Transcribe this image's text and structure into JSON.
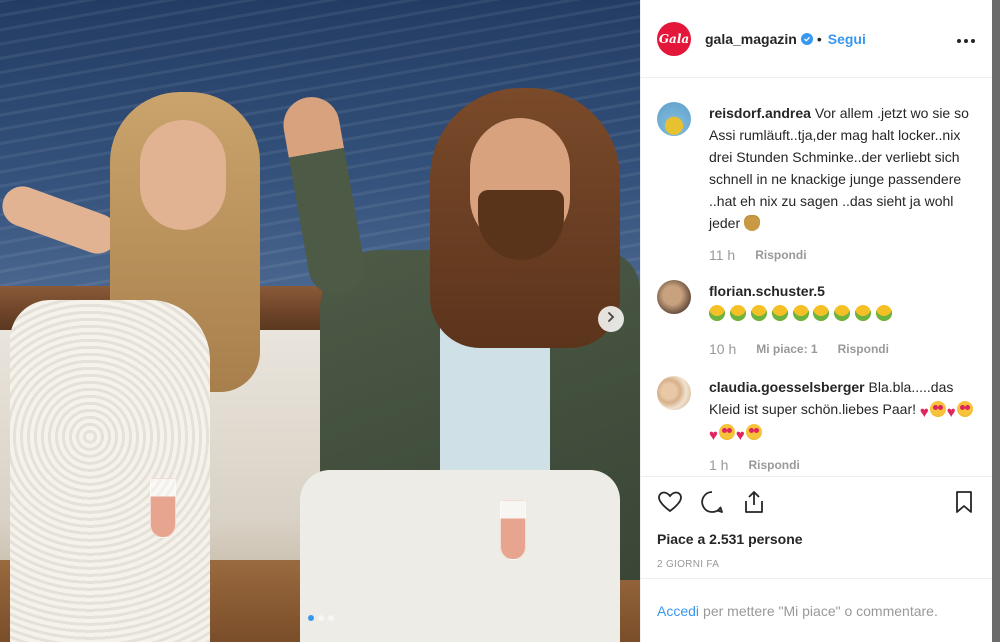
{
  "post": {
    "account": {
      "avatar_text": "Gala",
      "username": "gala_magazin",
      "separator": "•",
      "follow_label": "Segui",
      "more_label": "•••",
      "brand_color": "#e4173a",
      "verified_icon": "verified-badge-icon"
    },
    "carousel": {
      "next_icon": "chevron-right-icon",
      "slide_count": 3,
      "active_slide": 1
    },
    "comments": [
      {
        "username": "reisdorf.andrea",
        "text": "Vor allem .jetzt wo sie so Assi rumläuft..tja,der mag halt locker..nix drei Stunden Schminke..der verliebt sich schnell in ne knackige junge passendere ..hat eh nix zu sagen ..das sieht ja wohl jeder",
        "emoji": "money-bag-emoji",
        "time": "11 h",
        "reply_label": "Rispondi"
      },
      {
        "username": "florian.schuster.5",
        "emoji": "nauseated-face-emoji",
        "emoji_count": 9,
        "time": "10 h",
        "likes_label": "Mi piace: 1",
        "reply_label": "Rispondi"
      },
      {
        "username": "claudia.goesselsberger",
        "text_line1": "Bla.bla.....das Kleid ist super schön.liebes Paar!",
        "emoji_sequence": [
          "heart",
          "heart-eyes",
          "heart",
          "heart-eyes",
          "heart",
          "heart-eyes",
          "heart",
          "heart-eyes"
        ],
        "time": "1 h",
        "reply_label": "Rispondi"
      }
    ],
    "actions": {
      "like_icon": "heart-icon",
      "comment_icon": "comment-bubble-icon",
      "share_icon": "share-upload-icon",
      "save_icon": "bookmark-icon"
    },
    "likes_text": "Piace a 2.531 persone",
    "date_text": "2 GIORNI FA",
    "login": {
      "link_label": "Accedi",
      "rest_text": "per mettere \"Mi piace\" o commentare."
    },
    "accent_color": "#3897f0"
  }
}
